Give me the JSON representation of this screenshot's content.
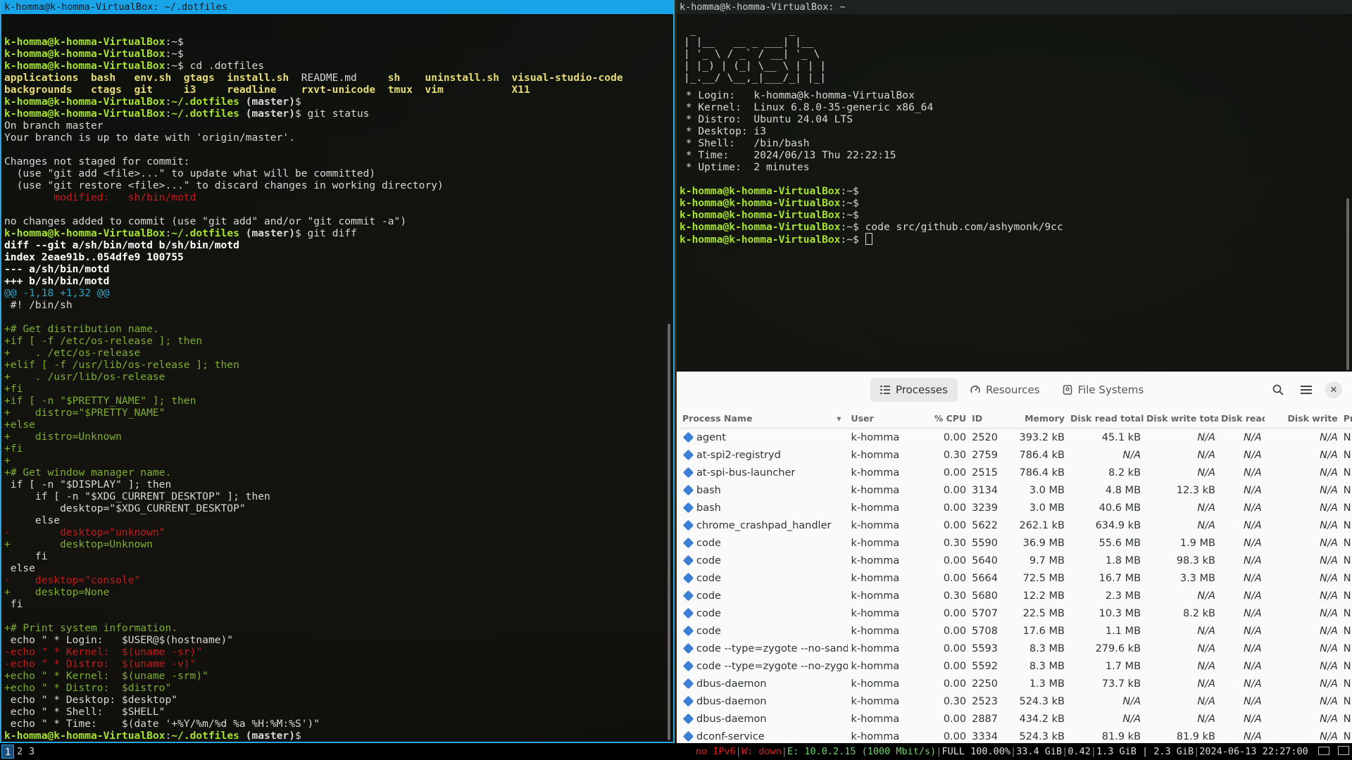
{
  "left_terminal": {
    "title": "k-homma@k-homma-VirtualBox: ~/.dotfiles",
    "prompt_home": "k-homma@k-homma-VirtualBox",
    "lines": [
      {
        "segs": []
      },
      {
        "segs": [
          {
            "c": "prompt",
            "t": "k-homma@k-homma-VirtualBox"
          },
          {
            "c": "text",
            "t": ":~$"
          }
        ]
      },
      {
        "segs": [
          {
            "c": "prompt",
            "t": "k-homma@k-homma-VirtualBox"
          },
          {
            "c": "text",
            "t": ":~$"
          }
        ]
      },
      {
        "segs": [
          {
            "c": "prompt",
            "t": "k-homma@k-homma-VirtualBox"
          },
          {
            "c": "text",
            "t": ":~$ cd .dotfiles"
          }
        ]
      },
      {
        "segs": [
          {
            "c": "yellow",
            "t": "applications  bash   env.sh  gtags  install.sh  "
          },
          {
            "c": "text",
            "t": "README.md     "
          },
          {
            "c": "yellow",
            "t": "sh    uninstall.sh  visual-studio-code"
          }
        ]
      },
      {
        "segs": [
          {
            "c": "yellow",
            "t": "backgrounds   ctags  git     i3     readline    rxvt-unicode  tmux  vim           X11"
          }
        ]
      },
      {
        "segs": [
          {
            "c": "prompt",
            "t": "k-homma@k-homma-VirtualBox"
          },
          {
            "c": "text",
            "t": ":"
          },
          {
            "c": "path",
            "t": "~/.dotfiles"
          },
          {
            "c": "branch",
            "t": " (master)"
          },
          {
            "c": "text",
            "t": "$"
          }
        ]
      },
      {
        "segs": [
          {
            "c": "prompt",
            "t": "k-homma@k-homma-VirtualBox"
          },
          {
            "c": "text",
            "t": ":"
          },
          {
            "c": "path",
            "t": "~/.dotfiles"
          },
          {
            "c": "branch",
            "t": " (master)"
          },
          {
            "c": "text",
            "t": "$ git status"
          }
        ]
      },
      {
        "segs": [
          {
            "c": "text",
            "t": "On branch master"
          }
        ]
      },
      {
        "segs": [
          {
            "c": "text",
            "t": "Your branch is up to date with 'origin/master'."
          }
        ]
      },
      {
        "segs": []
      },
      {
        "segs": [
          {
            "c": "text",
            "t": "Changes not staged for commit:"
          }
        ]
      },
      {
        "segs": [
          {
            "c": "text",
            "t": "  (use \"git add <file>...\" to update what will be committed)"
          }
        ]
      },
      {
        "segs": [
          {
            "c": "text",
            "t": "  (use \"git restore <file>...\" to discard changes in working directory)"
          }
        ]
      },
      {
        "segs": [
          {
            "c": "red",
            "t": "        modified:   sh/bin/motd"
          }
        ]
      },
      {
        "segs": []
      },
      {
        "segs": [
          {
            "c": "text",
            "t": "no changes added to commit (use \"git add\" and/or \"git commit -a\")"
          }
        ]
      },
      {
        "segs": [
          {
            "c": "prompt",
            "t": "k-homma@k-homma-VirtualBox"
          },
          {
            "c": "text",
            "t": ":"
          },
          {
            "c": "path",
            "t": "~/.dotfiles"
          },
          {
            "c": "branch",
            "t": " (master)"
          },
          {
            "c": "text",
            "t": "$ git diff"
          }
        ]
      },
      {
        "segs": [
          {
            "c": "white",
            "t": "diff --git a/sh/bin/motd b/sh/bin/motd"
          }
        ]
      },
      {
        "segs": [
          {
            "c": "white",
            "t": "index 2eae91b..054dfe9 100755"
          }
        ]
      },
      {
        "segs": [
          {
            "c": "white",
            "t": "--- a/sh/bin/motd"
          }
        ]
      },
      {
        "segs": [
          {
            "c": "white",
            "t": "+++ b/sh/bin/motd"
          }
        ]
      },
      {
        "segs": [
          {
            "c": "cyan",
            "t": "@@ -1,18 +1,32 @@"
          }
        ]
      },
      {
        "segs": [
          {
            "c": "text",
            "t": " #! /bin/sh"
          }
        ]
      },
      {
        "segs": []
      },
      {
        "segs": [
          {
            "c": "green",
            "t": "+# Get distribution name."
          }
        ]
      },
      {
        "segs": [
          {
            "c": "green",
            "t": "+if [ -f /etc/os-release ]; then"
          }
        ]
      },
      {
        "segs": [
          {
            "c": "green",
            "t": "+    . /etc/os-release"
          }
        ]
      },
      {
        "segs": [
          {
            "c": "green",
            "t": "+elif [ -f /usr/lib/os-release ]; then"
          }
        ]
      },
      {
        "segs": [
          {
            "c": "green",
            "t": "+    . /usr/lib/os-release"
          }
        ]
      },
      {
        "segs": [
          {
            "c": "green",
            "t": "+fi"
          }
        ]
      },
      {
        "segs": [
          {
            "c": "green",
            "t": "+if [ -n \"$PRETTY_NAME\" ]; then"
          }
        ]
      },
      {
        "segs": [
          {
            "c": "green",
            "t": "+    distro=\"$PRETTY_NAME\""
          }
        ]
      },
      {
        "segs": [
          {
            "c": "green",
            "t": "+else"
          }
        ]
      },
      {
        "segs": [
          {
            "c": "green",
            "t": "+    distro=Unknown"
          }
        ]
      },
      {
        "segs": [
          {
            "c": "green",
            "t": "+fi"
          }
        ]
      },
      {
        "segs": [
          {
            "c": "green",
            "t": "+"
          }
        ]
      },
      {
        "segs": [
          {
            "c": "green",
            "t": "+# Get window manager name."
          }
        ]
      },
      {
        "segs": [
          {
            "c": "text",
            "t": " if [ -n \"$DISPLAY\" ]; then"
          }
        ]
      },
      {
        "segs": [
          {
            "c": "text",
            "t": "     if [ -n \"$XDG_CURRENT_DESKTOP\" ]; then"
          }
        ]
      },
      {
        "segs": [
          {
            "c": "text",
            "t": "         desktop=\"$XDG_CURRENT_DESKTOP\""
          }
        ]
      },
      {
        "segs": [
          {
            "c": "text",
            "t": "     else"
          }
        ]
      },
      {
        "segs": [
          {
            "c": "red",
            "t": "-        desktop=\"unknown\""
          }
        ]
      },
      {
        "segs": [
          {
            "c": "green",
            "t": "+        desktop=Unknown"
          }
        ]
      },
      {
        "segs": [
          {
            "c": "text",
            "t": "     fi"
          }
        ]
      },
      {
        "segs": [
          {
            "c": "text",
            "t": " else"
          }
        ]
      },
      {
        "segs": [
          {
            "c": "red",
            "t": "-    desktop=\"console\""
          }
        ]
      },
      {
        "segs": [
          {
            "c": "green",
            "t": "+    desktop=None"
          }
        ]
      },
      {
        "segs": [
          {
            "c": "text",
            "t": " fi"
          }
        ]
      },
      {
        "segs": []
      },
      {
        "segs": [
          {
            "c": "green",
            "t": "+# Print system information."
          }
        ]
      },
      {
        "segs": [
          {
            "c": "text",
            "t": " echo \" * Login:   $USER@$(hostname)\""
          }
        ]
      },
      {
        "segs": [
          {
            "c": "red",
            "t": "-echo \" * Kernel:  $(uname -sr)\""
          }
        ]
      },
      {
        "segs": [
          {
            "c": "red",
            "t": "-echo \" * Distro:  $(uname -v)\""
          }
        ]
      },
      {
        "segs": [
          {
            "c": "green",
            "t": "+echo \" * Kernel:  $(uname -srm)\""
          }
        ]
      },
      {
        "segs": [
          {
            "c": "green",
            "t": "+echo \" * Distro:  $distro\""
          }
        ]
      },
      {
        "segs": [
          {
            "c": "text",
            "t": " echo \" * Desktop: $desktop\""
          }
        ]
      },
      {
        "segs": [
          {
            "c": "text",
            "t": " echo \" * Shell:   $SHELL\""
          }
        ]
      },
      {
        "segs": [
          {
            "c": "text",
            "t": " echo \" * Time:    $(date '+%Y/%m/%d %a %H:%M:%S')\""
          }
        ]
      },
      {
        "segs": [
          {
            "c": "prompt",
            "t": "k-homma@k-homma-VirtualBox"
          },
          {
            "c": "text",
            "t": ":"
          },
          {
            "c": "path",
            "t": "~/.dotfiles"
          },
          {
            "c": "branch",
            "t": " (master)"
          },
          {
            "c": "text",
            "t": "$"
          }
        ]
      }
    ]
  },
  "right_terminal": {
    "title": "k-homma@k-homma-VirtualBox: ~",
    "banner": [
      " _               _     ",
      "| |__   __ _ ___| |__  ",
      "| '_ \\ / _` / __| '_ \\ ",
      "| |_) | (_| \\__ \\ | | |",
      "|_.__/ \\__,_|___/_| |_|"
    ],
    "lines": [
      {
        "segs": [
          {
            "c": "text",
            "t": " * Login:   k-homma@k-homma-VirtualBox"
          }
        ]
      },
      {
        "segs": [
          {
            "c": "text",
            "t": " * Kernel:  Linux 6.8.0-35-generic x86_64"
          }
        ]
      },
      {
        "segs": [
          {
            "c": "text",
            "t": " * Distro:  Ubuntu 24.04 LTS"
          }
        ]
      },
      {
        "segs": [
          {
            "c": "text",
            "t": " * Desktop: i3"
          }
        ]
      },
      {
        "segs": [
          {
            "c": "text",
            "t": " * Shell:   /bin/bash"
          }
        ]
      },
      {
        "segs": [
          {
            "c": "text",
            "t": " * Time:    2024/06/13 Thu 22:22:15"
          }
        ]
      },
      {
        "segs": [
          {
            "c": "text",
            "t": " * Uptime:  2 minutes"
          }
        ]
      },
      {
        "segs": []
      },
      {
        "segs": [
          {
            "c": "prompt",
            "t": "k-homma@k-homma-VirtualBox"
          },
          {
            "c": "text",
            "t": ":~$"
          }
        ]
      },
      {
        "segs": [
          {
            "c": "prompt",
            "t": "k-homma@k-homma-VirtualBox"
          },
          {
            "c": "text",
            "t": ":~$"
          }
        ]
      },
      {
        "segs": [
          {
            "c": "prompt",
            "t": "k-homma@k-homma-VirtualBox"
          },
          {
            "c": "text",
            "t": ":~$"
          }
        ]
      },
      {
        "segs": [
          {
            "c": "prompt",
            "t": "k-homma@k-homma-VirtualBox"
          },
          {
            "c": "text",
            "t": ":~$ code src/github.com/ashymonk/9cc"
          }
        ]
      },
      {
        "segs": [
          {
            "c": "prompt",
            "t": "k-homma@k-homma-VirtualBox"
          },
          {
            "c": "text",
            "t": ":~$ "
          }
        ],
        "cursor": true
      }
    ]
  },
  "system_monitor": {
    "tabs": [
      {
        "label": "Processes",
        "icon": "list-icon",
        "active": true
      },
      {
        "label": "Resources",
        "icon": "gauge-icon",
        "active": false
      },
      {
        "label": "File Systems",
        "icon": "disk-icon",
        "active": false
      }
    ],
    "columns": [
      "Process Name",
      "User",
      "% CPU",
      "ID",
      "Memory",
      "Disk read total",
      "Disk write total",
      "Disk read",
      "Disk write",
      "Pr"
    ],
    "rows": [
      [
        "agent",
        "k-homma",
        "0.00",
        "2520",
        "393.2 kB",
        "45.1 kB",
        "N/A",
        "N/A",
        "N/A",
        "N"
      ],
      [
        "at-spi2-registryd",
        "k-homma",
        "0.30",
        "2759",
        "786.4 kB",
        "N/A",
        "N/A",
        "N/A",
        "N/A",
        "N"
      ],
      [
        "at-spi-bus-launcher",
        "k-homma",
        "0.00",
        "2515",
        "786.4 kB",
        "8.2 kB",
        "N/A",
        "N/A",
        "N/A",
        "N"
      ],
      [
        "bash",
        "k-homma",
        "0.00",
        "3134",
        "3.0 MB",
        "4.8 MB",
        "12.3 kB",
        "N/A",
        "N/A",
        "N"
      ],
      [
        "bash",
        "k-homma",
        "0.00",
        "3239",
        "3.0 MB",
        "40.6 MB",
        "N/A",
        "N/A",
        "N/A",
        "N"
      ],
      [
        "chrome_crashpad_handler",
        "k-homma",
        "0.00",
        "5622",
        "262.1 kB",
        "634.9 kB",
        "N/A",
        "N/A",
        "N/A",
        "N"
      ],
      [
        "code",
        "k-homma",
        "0.30",
        "5590",
        "36.9 MB",
        "55.6 MB",
        "1.9 MB",
        "N/A",
        "N/A",
        "N"
      ],
      [
        "code",
        "k-homma",
        "0.00",
        "5640",
        "9.7 MB",
        "1.8 MB",
        "98.3 kB",
        "N/A",
        "N/A",
        "N"
      ],
      [
        "code",
        "k-homma",
        "0.00",
        "5664",
        "72.5 MB",
        "16.7 MB",
        "3.3 MB",
        "N/A",
        "N/A",
        "N"
      ],
      [
        "code",
        "k-homma",
        "0.30",
        "5680",
        "12.2 MB",
        "2.3 MB",
        "N/A",
        "N/A",
        "N/A",
        "N"
      ],
      [
        "code",
        "k-homma",
        "0.00",
        "5707",
        "22.5 MB",
        "10.3 MB",
        "8.2 kB",
        "N/A",
        "N/A",
        "N"
      ],
      [
        "code",
        "k-homma",
        "0.00",
        "5708",
        "17.6 MB",
        "1.1 MB",
        "N/A",
        "N/A",
        "N/A",
        "N"
      ],
      [
        "code --type=zygote --no-sandbox",
        "k-homma",
        "0.00",
        "5593",
        "8.3 MB",
        "279.6 kB",
        "N/A",
        "N/A",
        "N/A",
        "N"
      ],
      [
        "code --type=zygote --no-zygote",
        "k-homma",
        "0.00",
        "5592",
        "8.3 MB",
        "1.7 MB",
        "N/A",
        "N/A",
        "N/A",
        "N"
      ],
      [
        "dbus-daemon",
        "k-homma",
        "0.00",
        "2250",
        "1.3 MB",
        "73.7 kB",
        "N/A",
        "N/A",
        "N/A",
        "N"
      ],
      [
        "dbus-daemon",
        "k-homma",
        "0.30",
        "2523",
        "524.3 kB",
        "N/A",
        "N/A",
        "N/A",
        "N/A",
        "N"
      ],
      [
        "dbus-daemon",
        "k-homma",
        "0.00",
        "2887",
        "434.2 kB",
        "N/A",
        "N/A",
        "N/A",
        "N/A",
        "N"
      ],
      [
        "dconf-service",
        "k-homma",
        "0.00",
        "3334",
        "524.3 kB",
        "81.9 kB",
        "81.9 kB",
        "N/A",
        "N/A",
        "N"
      ]
    ]
  },
  "status_bar": {
    "workspaces": [
      "1",
      "2",
      "3"
    ],
    "active_workspace": "1",
    "ipv6": "no IPv6",
    "wifi": "W: down",
    "ethernet": "E: 10.0.2.15 (1000 Mbit/s)",
    "battery": "FULL 100.00%",
    "disk": "33.4 GiB",
    "load": "0.42",
    "memory": "1.3 GiB | 2.3 GiB",
    "datetime": "2024-06-13 22:27:00"
  }
}
